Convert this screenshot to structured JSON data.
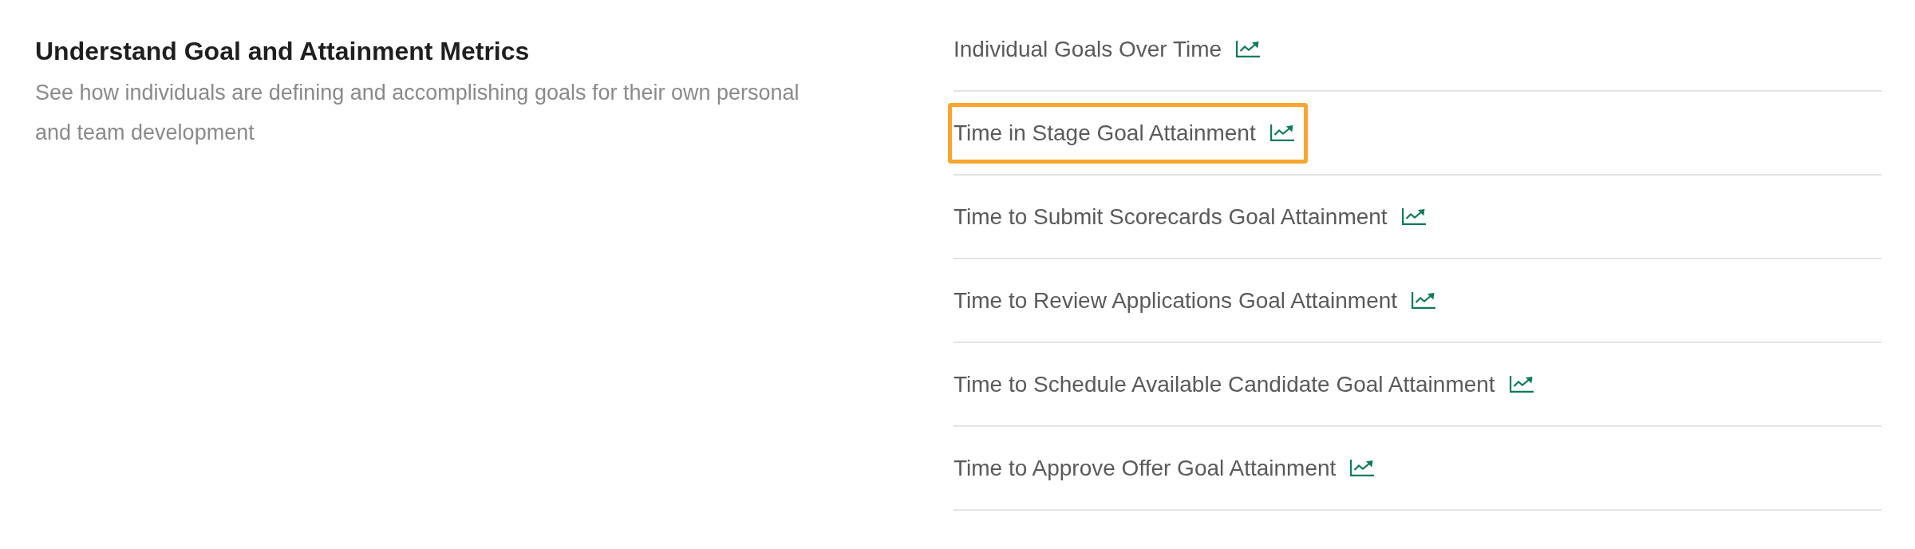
{
  "section": {
    "title": "Understand Goal and Attainment Metrics",
    "description": "See how individuals are defining and accomplishing goals for their own personal and team development"
  },
  "reports": [
    {
      "label": "Individual Goals Over Time",
      "highlighted": false
    },
    {
      "label": "Time in Stage Goal Attainment",
      "highlighted": true
    },
    {
      "label": "Time to Submit Scorecards Goal Attainment",
      "highlighted": false
    },
    {
      "label": "Time to Review Applications Goal Attainment",
      "highlighted": false
    },
    {
      "label": "Time to Schedule Available Candidate Goal Attainment",
      "highlighted": false
    },
    {
      "label": "Time to Approve Offer Goal Attainment",
      "highlighted": false
    }
  ]
}
